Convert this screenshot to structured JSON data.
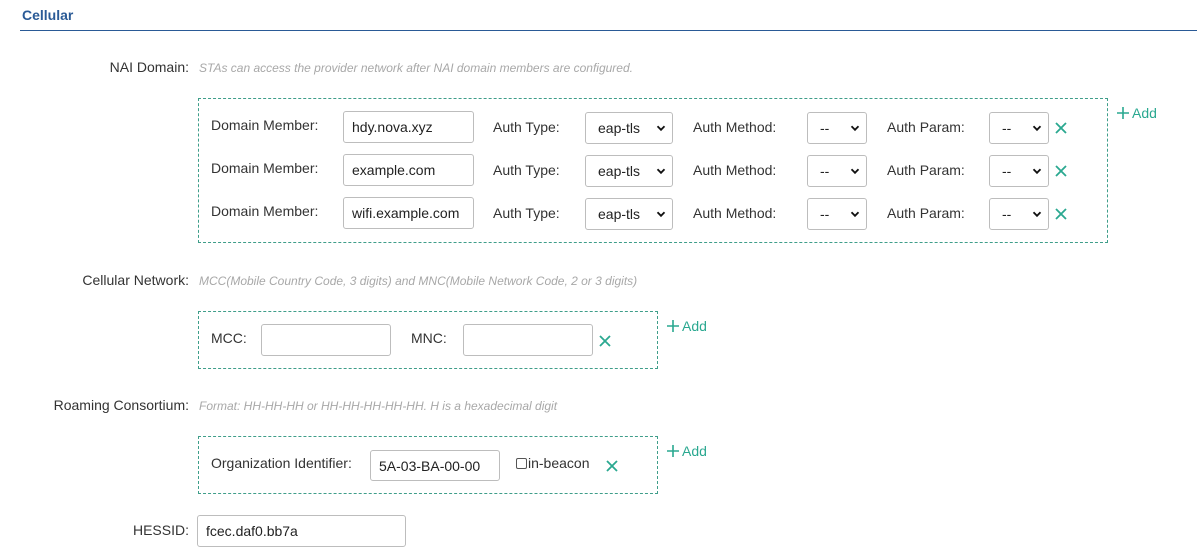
{
  "section": {
    "title": "Cellular"
  },
  "nai": {
    "label": "NAI Domain:",
    "hint": "STAs can access the provider network after NAI domain members are configured.",
    "add_label": "Add",
    "member_label": "Domain Member:",
    "auth_type_label": "Auth Type:",
    "auth_method_label": "Auth Method:",
    "auth_param_label": "Auth Param:",
    "rows": [
      {
        "member": "hdy.nova.xyz",
        "auth_type": "eap-tls",
        "auth_method": "--",
        "auth_param": "--"
      },
      {
        "member": "example.com",
        "auth_type": "eap-tls",
        "auth_method": "--",
        "auth_param": "--"
      },
      {
        "member": "wifi.example.com",
        "auth_type": "eap-tls",
        "auth_method": "--",
        "auth_param": "--"
      }
    ]
  },
  "cellular": {
    "label": "Cellular Network:",
    "hint": "MCC(Mobile Country Code, 3 digits) and MNC(Mobile Network Code, 2 or 3 digits)",
    "add_label": "Add",
    "mcc_label": "MCC:",
    "mnc_label": "MNC:",
    "mcc_value": "",
    "mnc_value": ""
  },
  "roaming": {
    "label": "Roaming Consortium:",
    "hint": "Format: HH-HH-HH or HH-HH-HH-HH-HH. H is a hexadecimal digit",
    "add_label": "Add",
    "org_label": "Organization Identifier:",
    "org_value": "5A-03-BA-00-00",
    "beacon_label": "in-beacon",
    "beacon_checked": false
  },
  "hessid": {
    "label": "HESSID:",
    "value": "fcec.daf0.bb7a"
  },
  "colors": {
    "accent": "#2aa890",
    "title": "#2a5a96",
    "dashed_border": "#3f9e8a"
  },
  "icons": {
    "remove": "close-icon",
    "add": "plus-icon",
    "dropdown": "chevron-down-icon"
  }
}
